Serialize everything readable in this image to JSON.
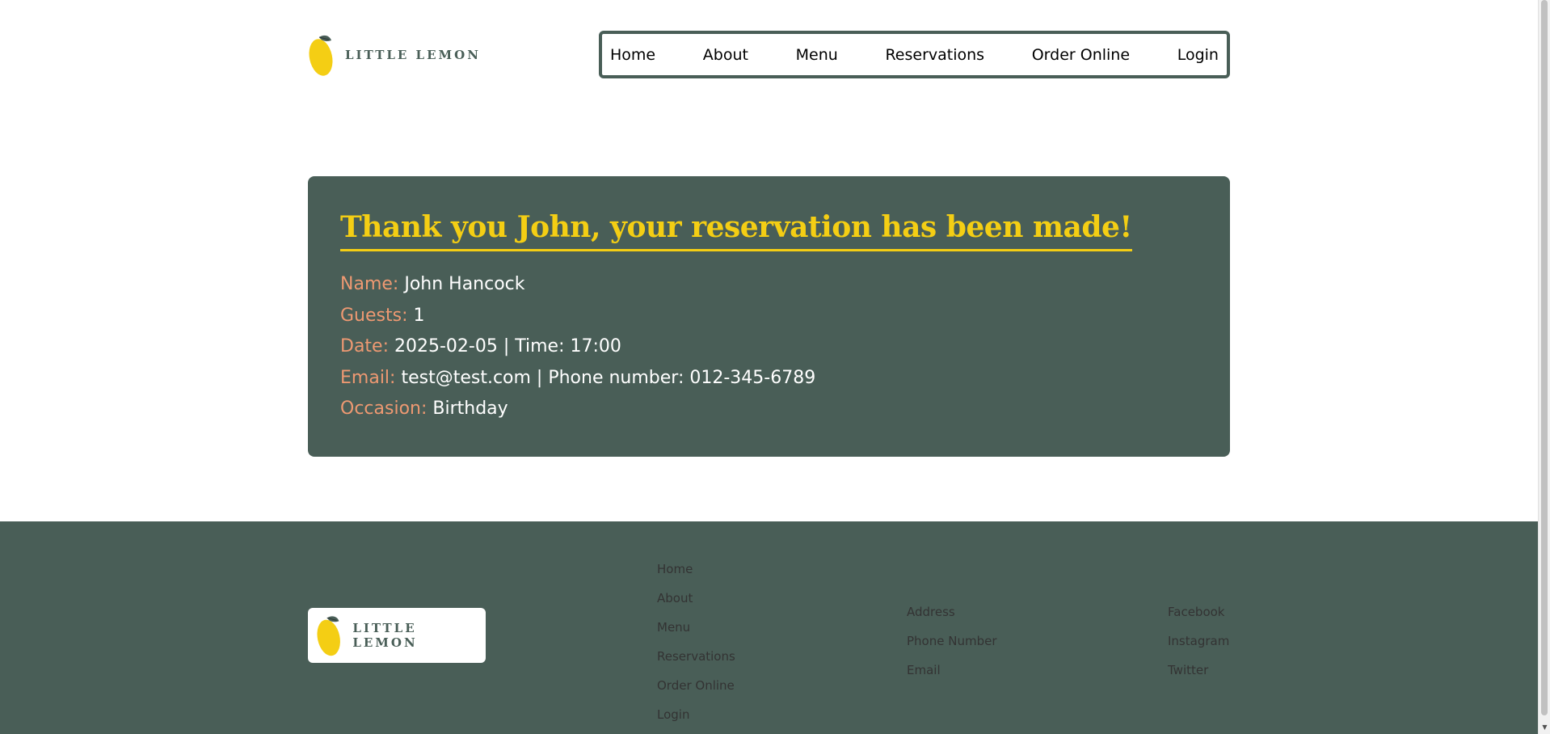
{
  "brand": {
    "name": "LITTLE LEMON",
    "colors": {
      "primary": "#495e57",
      "accent": "#f4ce14",
      "label": "#ee9972"
    },
    "icon": "lemon-icon"
  },
  "nav": {
    "items": [
      "Home",
      "About",
      "Menu",
      "Reservations",
      "Order Online",
      "Login"
    ]
  },
  "confirmation": {
    "title": "Thank you John, your reservation has been made!",
    "name_label": "Name:",
    "name_value": "John Hancock",
    "guests_label": "Guests:",
    "guests_value": "1",
    "date_label": "Date:",
    "date_value": "2025-02-05 | Time: 17:00",
    "email_label": "Email:",
    "email_value": "test@test.com | Phone number: 012-345-6789",
    "occasion_label": "Occasion:",
    "occasion_value": "Birthday"
  },
  "footer": {
    "logo_text": "LITTLE LEMON",
    "nav": [
      "Home",
      "About",
      "Menu",
      "Reservations",
      "Order Online",
      "Login"
    ],
    "contact": [
      "Address",
      "Phone Number",
      "Email"
    ],
    "social": [
      "Facebook",
      "Instagram",
      "Twitter"
    ]
  }
}
